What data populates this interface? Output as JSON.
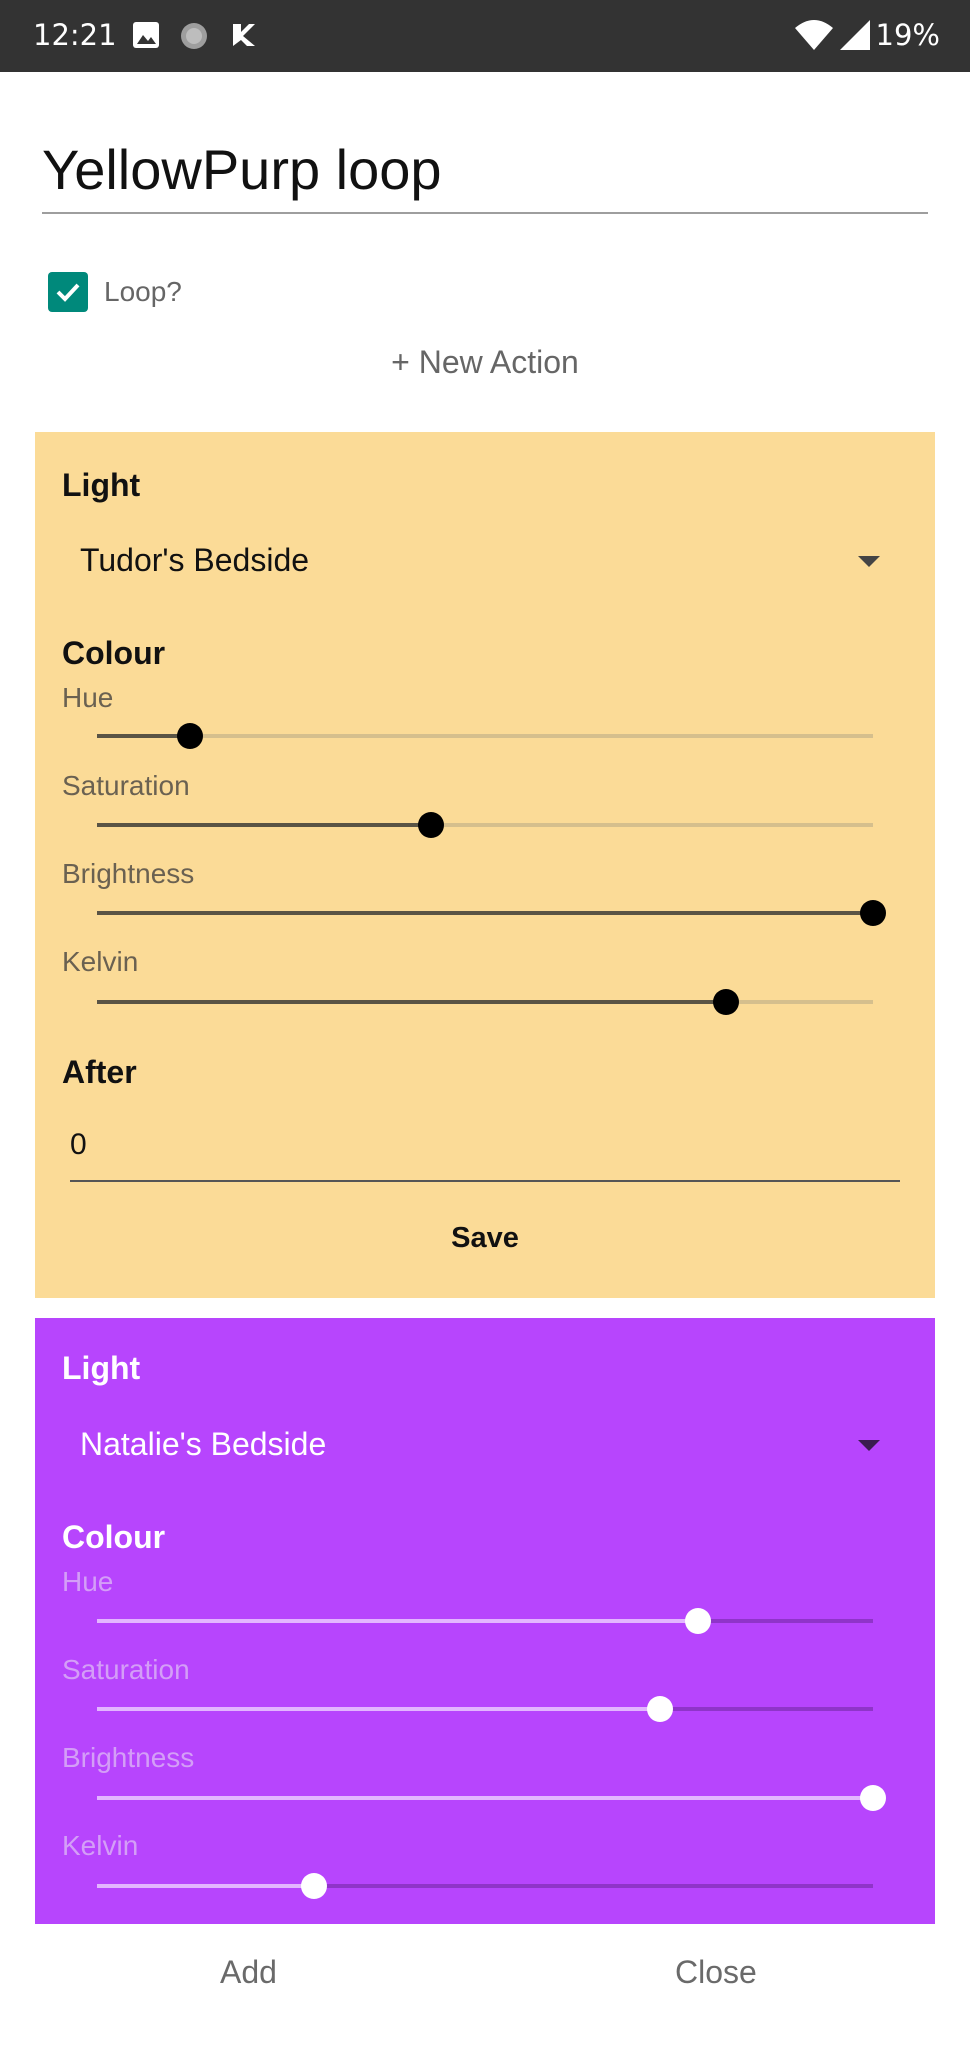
{
  "status_bar": {
    "time": "12:21",
    "battery": "19%",
    "icons": [
      "image-icon",
      "circle-app-icon",
      "tasks-icon",
      "wifi-icon",
      "signal-icon"
    ]
  },
  "title": "YellowPurp loop",
  "loop": {
    "label": "Loop?",
    "checked": true
  },
  "new_action_label": "+ New Action",
  "colors": {
    "yellow_card": "#fbdb97",
    "purple_card": "#b745fd",
    "checkbox": "#00897b"
  },
  "actions": [
    {
      "light_label": "Light",
      "light_value": "Tudor's Bedside",
      "colour_label": "Colour",
      "sliders": [
        {
          "label": "Hue",
          "value": 0.12
        },
        {
          "label": "Saturation",
          "value": 0.43
        },
        {
          "label": "Brightness",
          "value": 1.0
        },
        {
          "label": "Kelvin",
          "value": 0.81
        }
      ],
      "after_label": "After",
      "after_value": "0",
      "save_label": "Save"
    },
    {
      "light_label": "Light",
      "light_value": "Natalie's Bedside",
      "colour_label": "Colour",
      "sliders": [
        {
          "label": "Hue",
          "value": 0.775
        },
        {
          "label": "Saturation",
          "value": 0.725
        },
        {
          "label": "Brightness",
          "value": 1.0
        },
        {
          "label": "Kelvin",
          "value": 0.28
        }
      ]
    }
  ],
  "footer": {
    "add_label": "Add",
    "close_label": "Close"
  }
}
